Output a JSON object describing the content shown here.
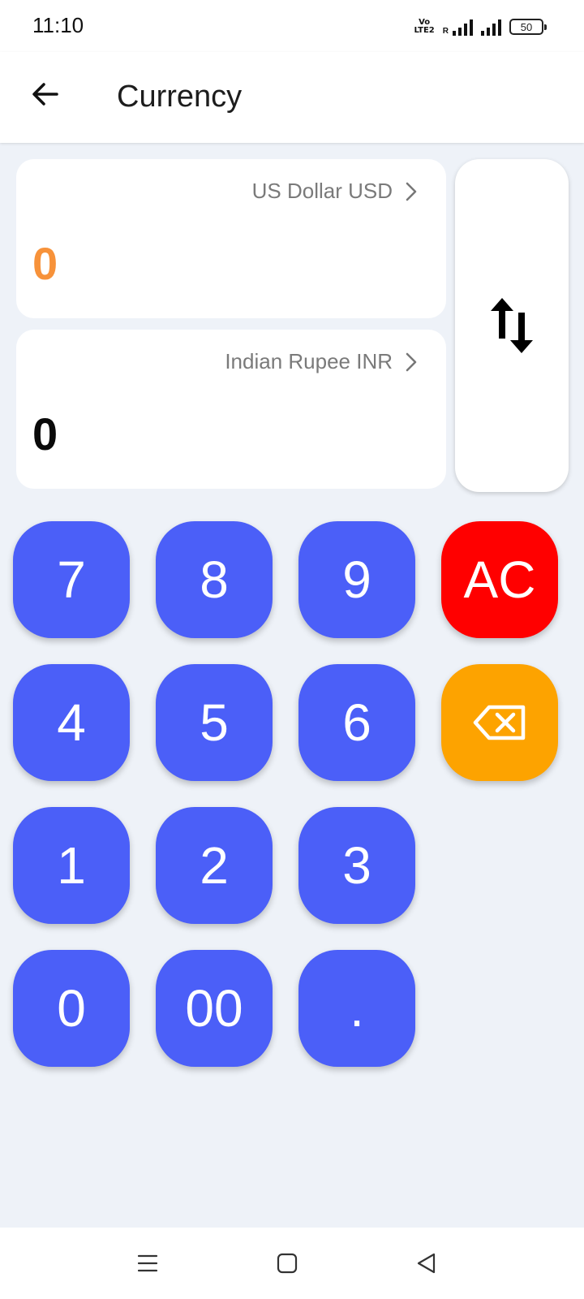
{
  "status_bar": {
    "time": "11:10",
    "volte_top": "Vo",
    "volte_bottom": "LTE2",
    "roaming": "R",
    "battery": "50"
  },
  "app_bar": {
    "title": "Currency",
    "back_icon": "arrow-left-icon"
  },
  "converter": {
    "from": {
      "currency": "US Dollar USD",
      "amount": "0",
      "amount_color": "#f7923a"
    },
    "to": {
      "currency": "Indian Rupee INR",
      "amount": "0",
      "amount_color": "#0a0a0a"
    },
    "swap_icon": "swap-vertical-icon"
  },
  "keypad": {
    "keys": [
      "7",
      "8",
      "9",
      "AC",
      "4",
      "5",
      "6",
      "1",
      "2",
      "3",
      "0",
      "00",
      "."
    ],
    "backspace_icon": "backspace-icon",
    "colors": {
      "digit": "#4b5ff8",
      "clear": "#ff0000",
      "backspace": "#fda300"
    }
  },
  "nav_bar": {
    "icons": [
      "menu-icon",
      "home-square-icon",
      "back-triangle-icon"
    ]
  }
}
